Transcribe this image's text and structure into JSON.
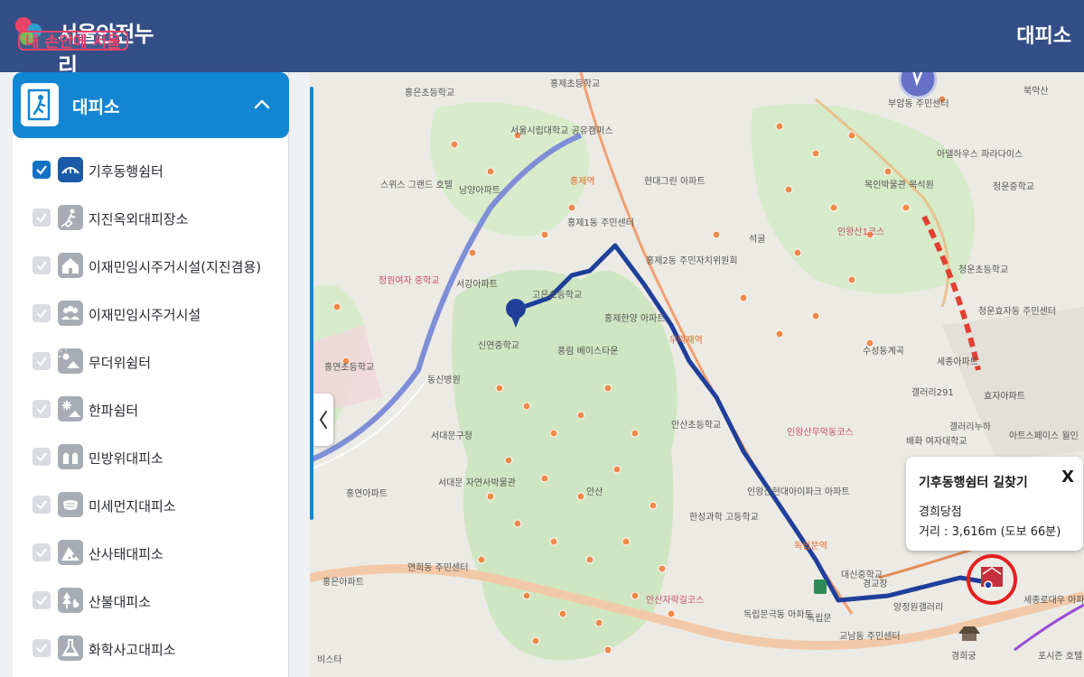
{
  "header": {
    "title": "서울안전누리",
    "slogan": "내 손안에 서울",
    "page_label": "대피소"
  },
  "sidebar": {
    "category_title": "대피소",
    "items": [
      {
        "label": "기후동행쉼터",
        "checked": true,
        "icon": "shelter-icon"
      },
      {
        "label": "지진옥외대피장소",
        "checked": false,
        "icon": "earthquake-icon"
      },
      {
        "label": "이재민임시주거시설(지진겸용)",
        "checked": false,
        "icon": "house-quake-icon"
      },
      {
        "label": "이재민임시주거시설",
        "checked": false,
        "icon": "people-icon"
      },
      {
        "label": "무더위쉼터",
        "checked": false,
        "icon": "sun-house-icon"
      },
      {
        "label": "한파쉼터",
        "checked": false,
        "icon": "snow-icon"
      },
      {
        "label": "민방위대피소",
        "checked": false,
        "icon": "civil-defense-icon"
      },
      {
        "label": "미세먼지대피소",
        "checked": false,
        "icon": "mask-icon"
      },
      {
        "label": "산사태대피소",
        "checked": false,
        "icon": "landslide-icon"
      },
      {
        "label": "산불대피소",
        "checked": false,
        "icon": "forest-fire-icon"
      },
      {
        "label": "화학사고대피소",
        "checked": false,
        "icon": "chemical-icon"
      }
    ]
  },
  "popup": {
    "title": "기후동행쉼터 길찾기",
    "close": "X",
    "place": "경희당점",
    "distance": "거리 : 3,616m (도보 66분)"
  },
  "map_labels": [
    {
      "text": "홍은초등학교",
      "c": ""
    },
    {
      "text": "서울시립대학교 공유캠퍼스",
      "c": ""
    },
    {
      "text": "홍제초등학교",
      "c": ""
    },
    {
      "text": "홍제역",
      "c": "orange"
    },
    {
      "text": "현대그린 아파트",
      "c": ""
    },
    {
      "text": "스위스 그랜드 호텔",
      "c": ""
    },
    {
      "text": "남양아파트",
      "c": ""
    },
    {
      "text": "홍제1동 주민센터",
      "c": ""
    },
    {
      "text": "홍제2동 주민자치위원회",
      "c": ""
    },
    {
      "text": "정원여자 중학교",
      "c": "pink"
    },
    {
      "text": "서강아파트",
      "c": ""
    },
    {
      "text": "고은초등학교",
      "c": ""
    },
    {
      "text": "홍제한양 아파트",
      "c": ""
    },
    {
      "text": "무악재역",
      "c": "orange"
    },
    {
      "text": "신연중학교",
      "c": ""
    },
    {
      "text": "풍림 베이스타운",
      "c": ""
    },
    {
      "text": "홍연초등학교",
      "c": ""
    },
    {
      "text": "동신병원",
      "c": ""
    },
    {
      "text": "서대문구청",
      "c": ""
    },
    {
      "text": "안산초등학교",
      "c": ""
    },
    {
      "text": "인왕산무악동코스",
      "c": "pink"
    },
    {
      "text": "서대문 자연사박물관",
      "c": ""
    },
    {
      "text": "홍연아파트",
      "c": ""
    },
    {
      "text": "안산",
      "c": ""
    },
    {
      "text": "한성과학 고등학교",
      "c": ""
    },
    {
      "text": "연희동 주민센터",
      "c": ""
    },
    {
      "text": "홍은아파트",
      "c": ""
    },
    {
      "text": "안산자락길코스",
      "c": "pink"
    },
    {
      "text": "독립문역",
      "c": "orange"
    },
    {
      "text": "대신중학교",
      "c": ""
    },
    {
      "text": "교남동 주민센터",
      "c": ""
    },
    {
      "text": "양정원갤러리",
      "c": ""
    },
    {
      "text": "독립문극동 아파트",
      "c": ""
    },
    {
      "text": "독립문",
      "c": ""
    },
    {
      "text": "비스타",
      "c": ""
    },
    {
      "text": "북악산",
      "c": ""
    },
    {
      "text": "부암동 주민센터",
      "c": ""
    },
    {
      "text": "아델하우스 파라다이스",
      "c": ""
    },
    {
      "text": "청운중학교",
      "c": ""
    },
    {
      "text": "목인박물관 목석원",
      "c": ""
    },
    {
      "text": "석굴",
      "c": ""
    },
    {
      "text": "인왕산1코스",
      "c": "pink"
    },
    {
      "text": "청운초등학교",
      "c": ""
    },
    {
      "text": "청운효자동 주민센터",
      "c": ""
    },
    {
      "text": "수성동계곡",
      "c": ""
    },
    {
      "text": "세종아파트",
      "c": ""
    },
    {
      "text": "갤러리291",
      "c": ""
    },
    {
      "text": "효자아파트",
      "c": ""
    },
    {
      "text": "배화 여자대학교",
      "c": ""
    },
    {
      "text": "갤러리누하",
      "c": ""
    },
    {
      "text": "아트스페이스 월인",
      "c": ""
    },
    {
      "text": "경희궁",
      "c": ""
    },
    {
      "text": "세종로대우 아파트",
      "c": ""
    },
    {
      "text": "포시즌 호텔",
      "c": ""
    },
    {
      "text": "경교장",
      "c": ""
    },
    {
      "text": "인왕산현대아이파크 아파트",
      "c": ""
    }
  ],
  "colors": {
    "header_bg": "#344f86",
    "accent": "#1386d3",
    "route": "#1f3f9a"
  }
}
